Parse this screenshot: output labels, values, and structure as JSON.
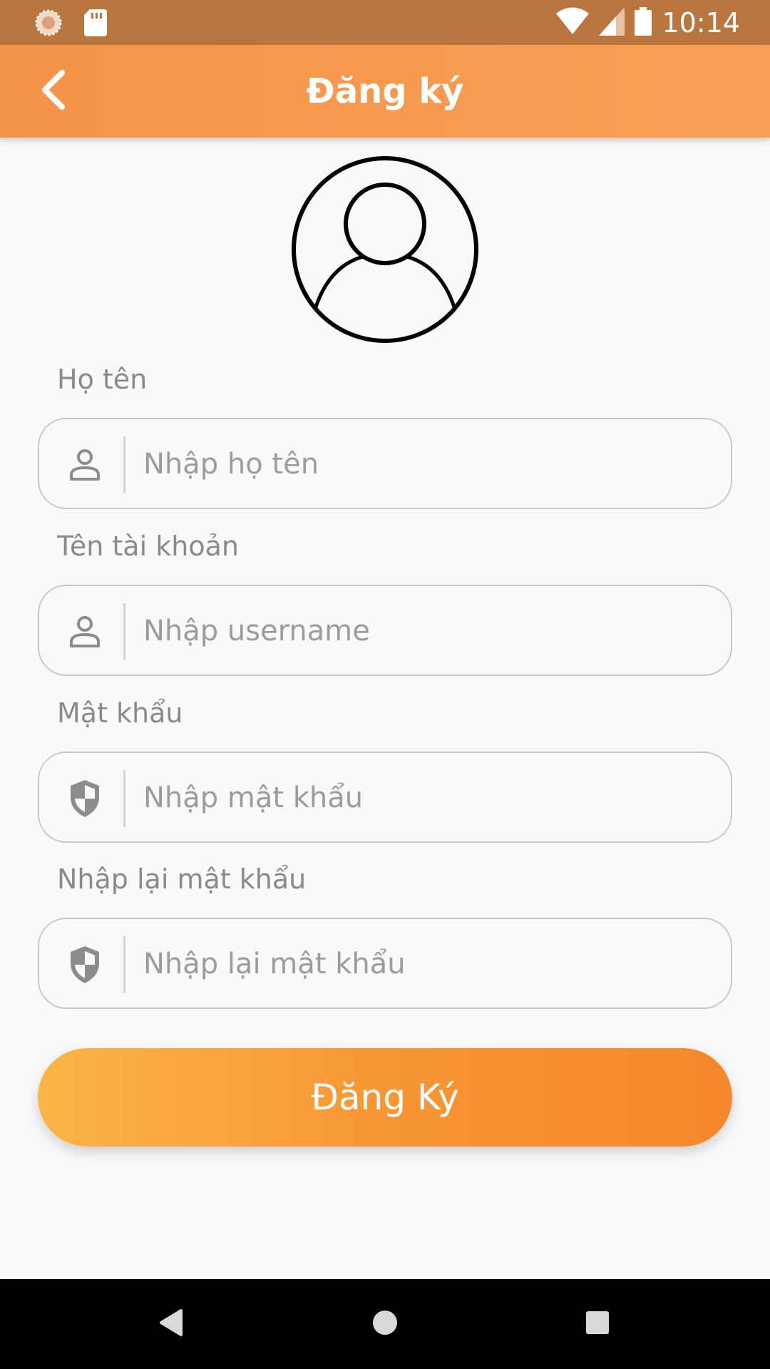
{
  "status_bar": {
    "time": "10:14",
    "left_icons": [
      "loading-icon",
      "sd-card-icon"
    ],
    "right_icons": [
      "wifi-icon",
      "signal-icon",
      "battery-icon"
    ]
  },
  "app_bar": {
    "title": "Đăng ký",
    "back_icon": "chevron-left-icon",
    "background": "#f6934a"
  },
  "avatar": {
    "icon": "user-circle-icon"
  },
  "form": {
    "full_name": {
      "label": "Họ tên",
      "placeholder": "Nhập họ tên",
      "value": "",
      "icon": "person-icon"
    },
    "username": {
      "label": "Tên tài khoản",
      "placeholder": "Nhập username",
      "value": "",
      "icon": "person-icon"
    },
    "password": {
      "label": "Mật khẩu",
      "placeholder": "Nhập mật khẩu",
      "value": "",
      "icon": "shield-icon"
    },
    "confirm_password": {
      "label": "Nhập lại mật khẩu",
      "placeholder": "Nhập lại mật khẩu",
      "value": "",
      "icon": "shield-icon"
    }
  },
  "register_button": {
    "label": "Đăng Ký",
    "gradient_start": "#fbb446",
    "gradient_end": "#f5872c"
  },
  "nav_bar": {
    "buttons": [
      "back-triangle-icon",
      "home-circle-icon",
      "recents-square-icon"
    ]
  }
}
